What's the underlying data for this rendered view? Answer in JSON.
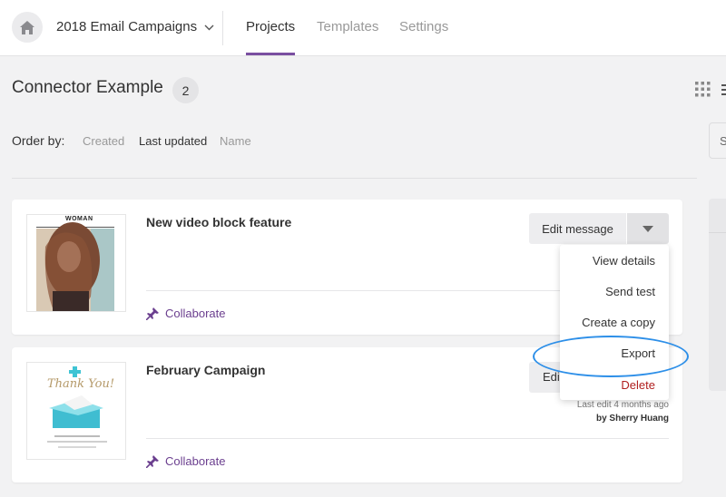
{
  "nav": {
    "workspace": "2018 Email Campaigns",
    "tabs": [
      {
        "label": "Projects",
        "active": true
      },
      {
        "label": "Templates",
        "active": false
      },
      {
        "label": "Settings",
        "active": false
      }
    ]
  },
  "header": {
    "title": "Connector Example",
    "count": "2"
  },
  "sort": {
    "label": "Order by:",
    "options": [
      {
        "label": "Created",
        "active": false
      },
      {
        "label": "Last updated",
        "active": true
      },
      {
        "label": "Name",
        "active": false
      }
    ]
  },
  "search": {
    "placeholder": "S"
  },
  "cards": [
    {
      "title": "New video block feature",
      "thumb_heading": "WOMAN",
      "edit_label": "Edit message",
      "collab_label": "Collaborate"
    },
    {
      "title": "February Campaign",
      "thumb_heading": "Thank You!",
      "edit_label": "Edi",
      "last_edit": "Last edit 4 months ago",
      "last_edit_by": "by Sherry Huang",
      "collab_label": "Collaborate"
    }
  ],
  "menu": {
    "items": [
      "View details",
      "Send test",
      "Create a copy",
      "Export",
      "Delete"
    ],
    "highlighted": "Export"
  },
  "colors": {
    "accent": "#7a4fa0",
    "collaborate": "#6b3f8f",
    "danger": "#b01e1e",
    "highlight_ring": "#2d8fe8"
  }
}
